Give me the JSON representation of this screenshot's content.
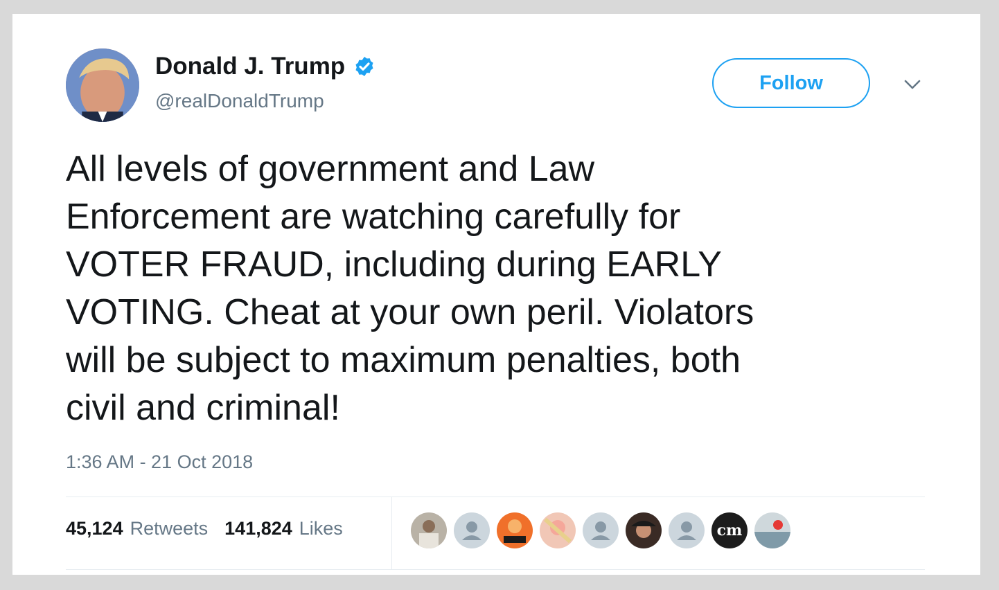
{
  "author": {
    "name": "Donald J. Trump",
    "handle": "@realDonaldTrump",
    "verified": true
  },
  "actions": {
    "follow_label": "Follow"
  },
  "tweet": {
    "lines": [
      "All levels of government and Law",
      "Enforcement are watching carefully for",
      "VOTER FRAUD, including during EARLY",
      "VOTING. Cheat at your own peril. Violators",
      "will be subject to maximum penalties, both",
      "civil and criminal!"
    ],
    "timestamp": "1:36 AM - 21 Oct 2018"
  },
  "stats": {
    "retweets_count": "45,124",
    "retweets_label": "Retweets",
    "likes_count": "141,824",
    "likes_label": "Likes"
  },
  "likers": {
    "cm_avatar_text": "cm"
  },
  "colors": {
    "accent": "#1da1f2",
    "text_primary": "#14171a",
    "text_secondary": "#657786"
  }
}
